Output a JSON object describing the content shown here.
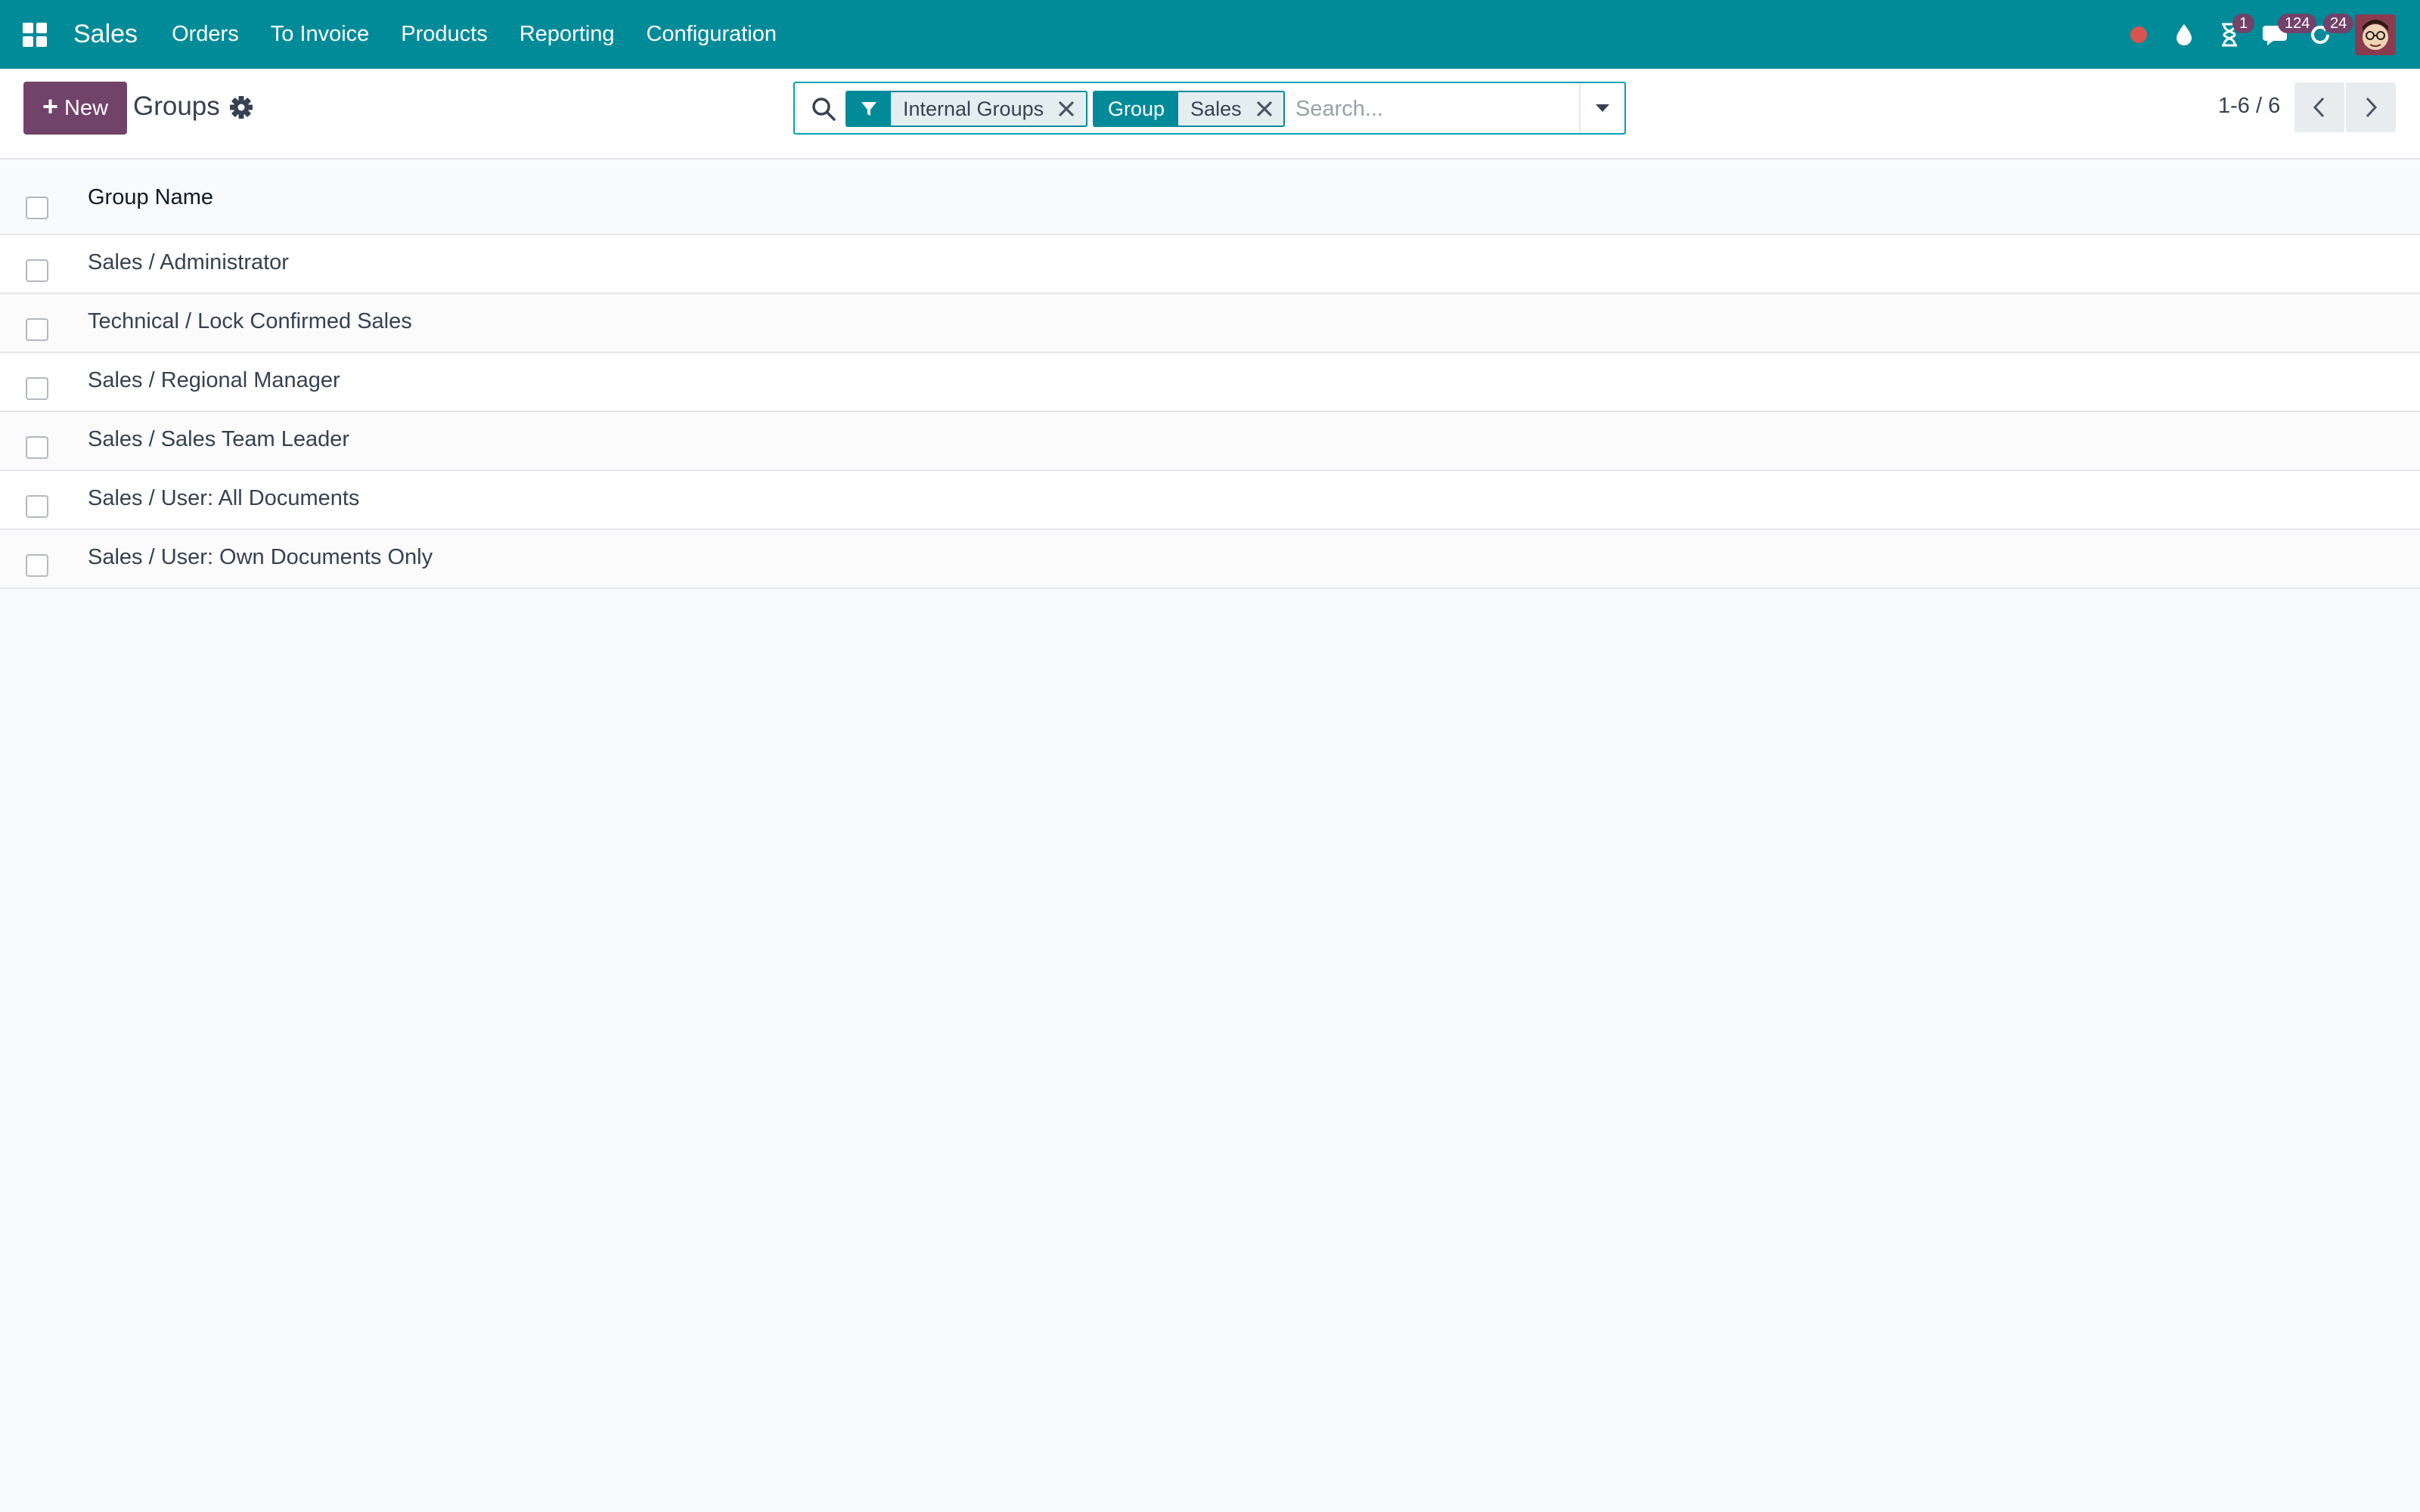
{
  "navbar": {
    "app_name": "Sales",
    "menu": [
      "Orders",
      "To Invoice",
      "Products",
      "Reporting",
      "Configuration"
    ],
    "icons": {
      "apps": "grid-icon",
      "status": "red-dot-icon",
      "drop": "droplet-icon",
      "activity": "hourglass-icon",
      "messages": "chat-icon",
      "updates": "refresh-icon"
    },
    "badges": {
      "activity": "1",
      "messages": "124",
      "updates": "24"
    },
    "colors": {
      "bar": "#018b99",
      "badge": "#71426a",
      "status_dot": "#d9534f"
    }
  },
  "control_panel": {
    "new_label": "New",
    "title": "Groups",
    "search": {
      "facets": [
        {
          "category": "",
          "category_icon": "filter-icon",
          "value": "Internal Groups"
        },
        {
          "category": "Group",
          "value": "Sales"
        }
      ],
      "placeholder": "Search..."
    },
    "pager": {
      "value": "1-6 / 6"
    },
    "colors": {
      "primary": "#71426a",
      "accent": "#018b99"
    }
  },
  "list": {
    "columns": [
      "Group Name"
    ],
    "rows": [
      "Sales / Administrator",
      "Technical / Lock Confirmed Sales",
      "Sales / Regional Manager",
      "Sales / Sales Team Leader",
      "Sales / User: All Documents",
      "Sales / User: Own Documents Only"
    ]
  }
}
